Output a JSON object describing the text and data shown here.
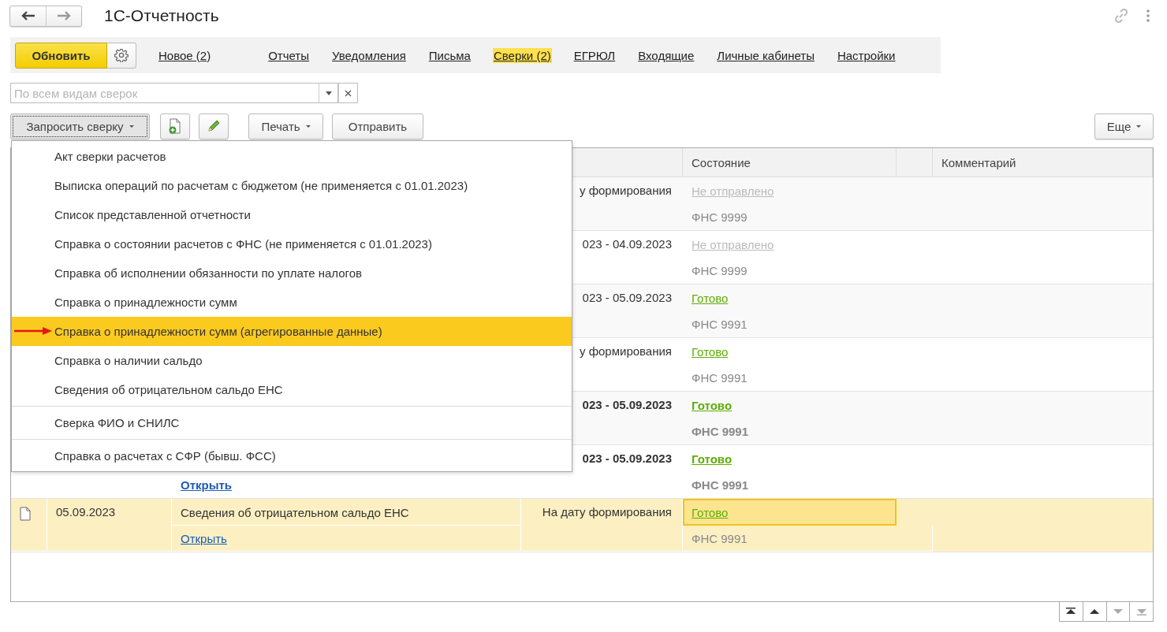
{
  "window": {
    "title": "1С-Отчетность"
  },
  "refresh_button": "Обновить",
  "tabs": [
    {
      "label": "Новое (2)",
      "selected": false
    },
    {
      "label": "Отчеты",
      "selected": false
    },
    {
      "label": "Уведомления",
      "selected": false
    },
    {
      "label": "Письма",
      "selected": false
    },
    {
      "label": "Сверки (2)",
      "selected": true
    },
    {
      "label": "ЕГРЮЛ",
      "selected": false
    },
    {
      "label": "Входящие",
      "selected": false
    },
    {
      "label": "Личные кабинеты",
      "selected": false
    },
    {
      "label": "Настройки",
      "selected": false
    }
  ],
  "filter": {
    "placeholder": "По всем видам сверок"
  },
  "commands": {
    "request": "Запросить сверку",
    "request_pressed": true,
    "print": "Печать",
    "send": "Отправить",
    "more": "Еще"
  },
  "menu": {
    "items": [
      {
        "label": "Акт сверки расчетов",
        "selected": false,
        "separator_before": false
      },
      {
        "label": "Выписка операций по расчетам с бюджетом (не применяется с 01.01.2023)",
        "selected": false,
        "separator_before": false
      },
      {
        "label": "Список представленной отчетности",
        "selected": false,
        "separator_before": false
      },
      {
        "label": "Справка о состоянии расчетов с ФНС (не применяется с 01.01.2023)",
        "selected": false,
        "separator_before": false
      },
      {
        "label": "Справка об исполнении обязанности по уплате налогов",
        "selected": false,
        "separator_before": false
      },
      {
        "label": "Справка о принадлежности сумм",
        "selected": false,
        "separator_before": false
      },
      {
        "label": "Справка о принадлежности сумм (агрегированные данные)",
        "selected": true,
        "separator_before": false
      },
      {
        "label": "Справка о наличии сальдо",
        "selected": false,
        "separator_before": false
      },
      {
        "label": "Сведения об отрицательном сальдо ЕНС",
        "selected": false,
        "separator_before": false
      },
      {
        "label": "Сверка ФИО и СНИЛС",
        "selected": false,
        "separator_before": true
      },
      {
        "label": "Справка о расчетах с СФР (бывш. ФСС)",
        "selected": false,
        "separator_before": true
      }
    ]
  },
  "table": {
    "columns": [
      "Состояние",
      "Комментарий"
    ],
    "rows": [
      {
        "period": "у формирования",
        "status": "Не отправлено",
        "status_ready": false,
        "recipient": "ФНС 9999",
        "bold": false,
        "selected": false
      },
      {
        "period": "023 - 04.09.2023",
        "status": "Не отправлено",
        "status_ready": false,
        "recipient": "ФНС 9999",
        "bold": false,
        "selected": false
      },
      {
        "period": "023 - 05.09.2023",
        "status": "Готово",
        "status_ready": true,
        "recipient": "ФНС 9991",
        "bold": false,
        "selected": false
      },
      {
        "period": "у формирования",
        "status": "Готово",
        "status_ready": true,
        "recipient": "ФНС 9991",
        "bold": false,
        "selected": false
      },
      {
        "period": "023 - 05.09.2023",
        "status": "Готово",
        "status_ready": true,
        "recipient": "ФНС 9991",
        "bold": true,
        "selected": false
      },
      {
        "open_link": "Открыть",
        "period": "023 - 05.09.2023",
        "status": "Готово",
        "status_ready": true,
        "recipient": "ФНС 9991",
        "bold": true,
        "selected": false
      },
      {
        "date": "05.09.2023",
        "document": "Сведения об отрицательном сальдо ЕНС",
        "open_link": "Открыть",
        "period": "На дату формирования",
        "status": "Готово",
        "status_ready": true,
        "recipient": "ФНС 9991",
        "bold": false,
        "selected": true
      }
    ]
  },
  "pager": {
    "buttons": [
      {
        "kind": "first",
        "disabled": false
      },
      {
        "kind": "up",
        "disabled": false
      },
      {
        "kind": "down",
        "disabled": true
      },
      {
        "kind": "last",
        "disabled": true
      }
    ]
  }
}
